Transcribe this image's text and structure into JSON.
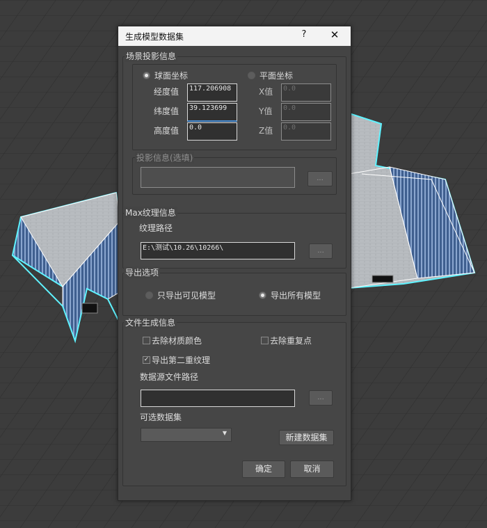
{
  "dialog": {
    "title": "生成模型数据集",
    "help_label": "?",
    "close_label": "✕"
  },
  "scene": {
    "group_title": "场景投影信息",
    "sphere_label": "球面坐标",
    "plane_label": "平面坐标",
    "lon_label": "经度值",
    "lon_value": "117.206908",
    "lat_label": "纬度值",
    "lat_value": "39.123699",
    "alt_label": "高度值",
    "alt_value": "0.0",
    "x_label": "X值",
    "x_value": "0.0",
    "y_label": "Y值",
    "y_value": "0.0",
    "z_label": "Z值",
    "z_value": "0.0",
    "projection_label": "投影信息(选填)",
    "projection_value": "",
    "projection_browse": "..."
  },
  "texture": {
    "group_title": "Max纹理信息",
    "path_label": "纹理路径",
    "path_value": "E:\\测试\\10.26\\10266\\",
    "browse": "..."
  },
  "export": {
    "group_title": "导出选项",
    "visible_only": "只导出可见模型",
    "all_models": "导出所有模型"
  },
  "file": {
    "group_title": "文件生成信息",
    "remove_material_color": "去除材质颜色",
    "remove_duplicate_points": "去除重复点",
    "export_second_texture": "导出第二重纹理",
    "source_path_label": "数据源文件路径",
    "source_path_value": "",
    "source_browse": "...",
    "optional_dataset_label": "可选数据集",
    "optional_dataset_value": "",
    "new_dataset": "新建数据集"
  },
  "actions": {
    "ok": "确定",
    "cancel": "取消"
  },
  "icons": {
    "dropdown": "chevron-down-icon",
    "check": "checkmark-icon"
  }
}
